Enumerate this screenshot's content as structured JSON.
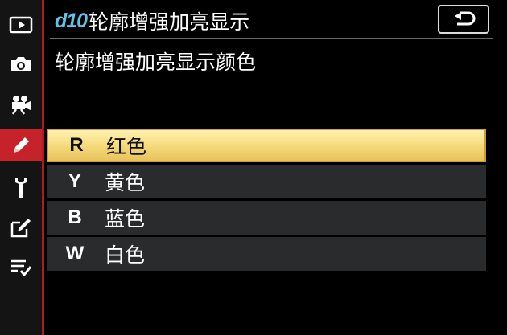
{
  "header": {
    "code": "d10",
    "title": "轮廓增强加亮显示"
  },
  "subtitle": "轮廓增强加亮显示颜色",
  "sidebar": {
    "items": [
      {
        "icon": "playback-icon"
      },
      {
        "icon": "camera-icon"
      },
      {
        "icon": "movie-icon"
      },
      {
        "icon": "pencil-icon",
        "active": true
      },
      {
        "icon": "wrench-icon"
      },
      {
        "icon": "retouch-icon"
      },
      {
        "icon": "my-menu-icon"
      }
    ]
  },
  "options": [
    {
      "key": "R",
      "label": "红色",
      "selected": true
    },
    {
      "key": "Y",
      "label": "黄色"
    },
    {
      "key": "B",
      "label": "蓝色"
    },
    {
      "key": "W",
      "label": "白色"
    }
  ],
  "colors": {
    "accent_red": "#c5222a",
    "code_blue": "#5fc4e8",
    "highlight_yellow": "#f3d878"
  }
}
